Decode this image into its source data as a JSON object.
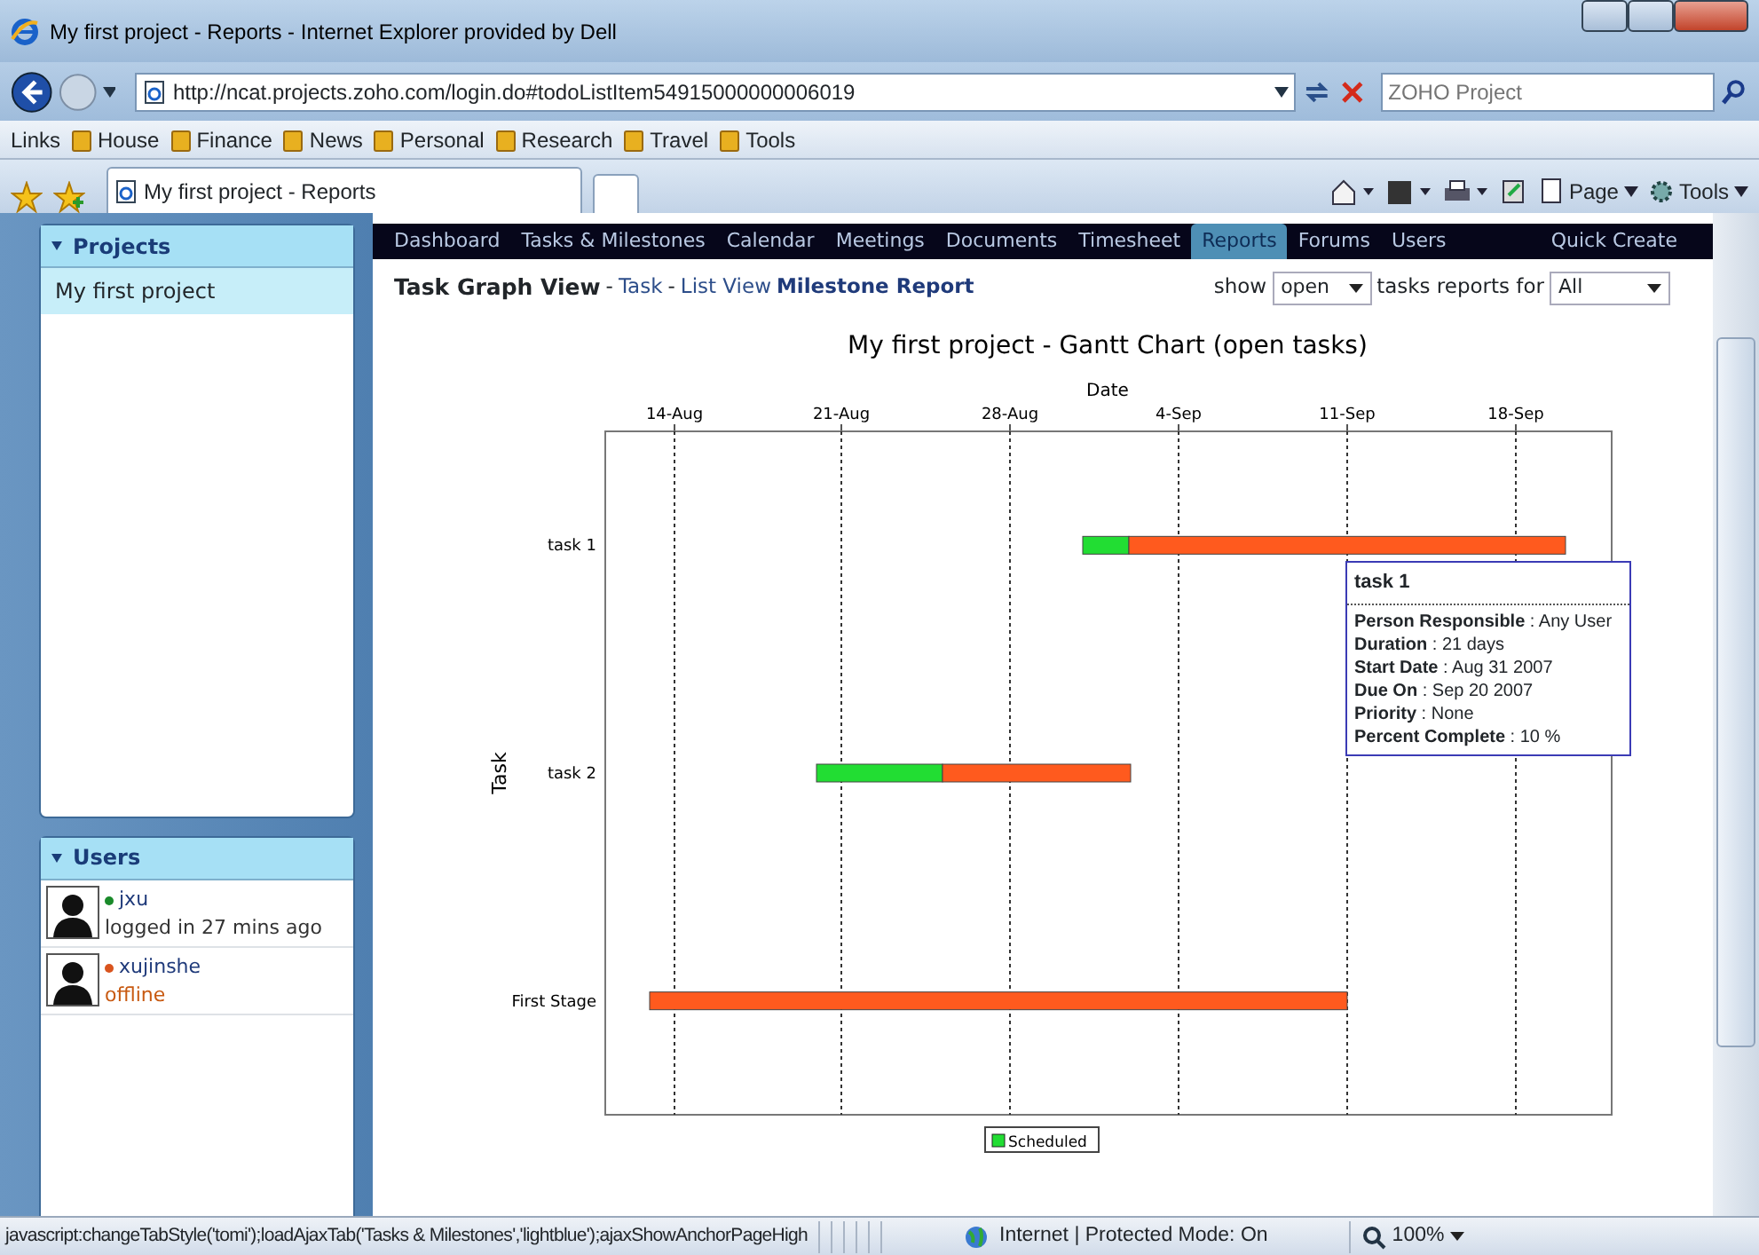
{
  "browser": {
    "title": "My first project - Reports - Internet Explorer provided by Dell",
    "address": "http://ncat.projects.zoho.com/login.do#todoListItem54915000000006019",
    "search_placeholder": "ZOHO Project",
    "links_label": "Links",
    "links": [
      "House",
      "Finance",
      "News",
      "Personal",
      "Research",
      "Travel",
      "Tools"
    ],
    "tab_title": "My first project - Reports",
    "menus": [
      "Page",
      "Tools"
    ]
  },
  "nav": {
    "items": [
      {
        "label": "Dashboard",
        "selected": false
      },
      {
        "label": "Tasks & Milestones",
        "selected": false
      },
      {
        "label": "Calendar",
        "selected": false
      },
      {
        "label": "Meetings",
        "selected": false
      },
      {
        "label": "Documents",
        "selected": false
      },
      {
        "label": "Timesheet",
        "selected": false
      },
      {
        "label": "Reports",
        "selected": true
      },
      {
        "label": "Forums",
        "selected": false
      },
      {
        "label": "Users",
        "selected": false
      }
    ],
    "quick_create": "Quick Create"
  },
  "sidebar": {
    "projects": {
      "header": "Projects",
      "items": [
        {
          "label": "My first project",
          "selected": true
        }
      ]
    },
    "users": {
      "header": "Users",
      "items": [
        {
          "name": "jxu",
          "status": "logged in 27 mins ago",
          "online": true,
          "color": "#1a8a2a"
        },
        {
          "name": "xujinshe",
          "status": "offline",
          "online": false,
          "color": "#d9541e"
        }
      ]
    }
  },
  "view_header": {
    "items": [
      {
        "text": "Task Graph View",
        "kind": "current"
      },
      {
        "text": "-",
        "kind": "sep"
      },
      {
        "text": "Task",
        "kind": "link"
      },
      {
        "text": "-",
        "kind": "sep"
      },
      {
        "text": "List View",
        "kind": "link"
      },
      {
        "text": "Milestone Report",
        "kind": "strong-link"
      }
    ],
    "show_label": "show",
    "show_value": "open",
    "for_label": "tasks reports for",
    "for_value": "All"
  },
  "chart": {
    "gantt": {
      "title": "My first project - Gantt Chart (open tasks)",
      "xlabel": "Date",
      "ylabel": "Task",
      "date_labels": [
        "14-Aug",
        "21-Aug",
        "28-Aug",
        "4-Sep",
        "11-Sep",
        "18-Sep"
      ],
      "tasks": [
        "task 1",
        "task 2",
        "First Stage"
      ],
      "legend": "Scheduled"
    },
    "tooltip": {
      "title": "task 1",
      "rows": [
        "**Person Responsible** : Any User",
        "**Duration** : 21 days",
        "**Start Date** : Aug 31 2007",
        "**Due On** : Sep 20 2007",
        "**Priority** : None",
        "**Percent Complete** : 10 %"
      ]
    }
  },
  "status_bar": {
    "text": "javascript:changeTabStyle('tomi');loadAjaxTab('Tasks & Milestones','lightblue');ajaxShowAnchorPageHigh",
    "zone": "Internet | Protected Mode: On",
    "zoom": "100%"
  }
}
